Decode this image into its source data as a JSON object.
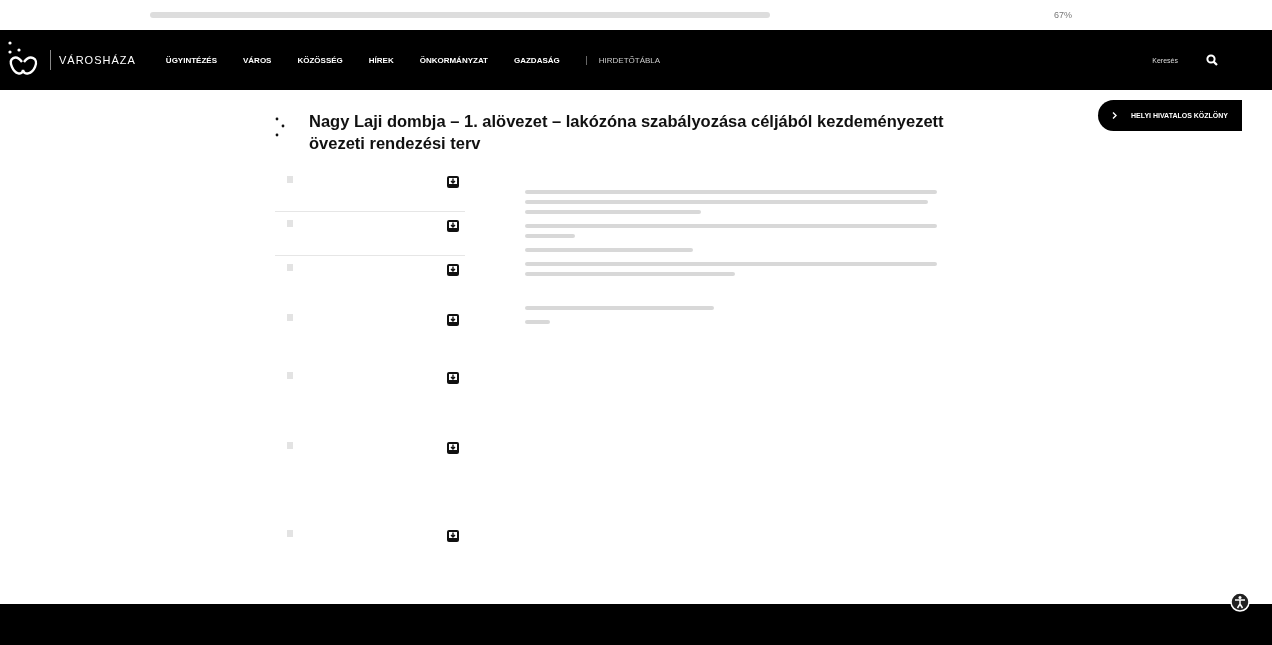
{
  "browser": {
    "zoom": "67%"
  },
  "header": {
    "logo_text": "VÁROSHÁZA",
    "nav": [
      {
        "label": "ÜGYINTÉZÉS",
        "kind": "main"
      },
      {
        "label": "VÁROS",
        "kind": "main"
      },
      {
        "label": "KÖZÖSSÉG",
        "kind": "main"
      },
      {
        "label": "HÍREK",
        "kind": "main"
      },
      {
        "label": "ÖNKORMÁNYZAT",
        "kind": "main"
      },
      {
        "label": "GAZDASÁG",
        "kind": "main"
      },
      {
        "label": "HIRDETŐTÁBLA",
        "kind": "secondary"
      }
    ],
    "search_label": "Keresés"
  },
  "gazette_button": "HELYI HIVATALOS KÖZLÖNY",
  "title": "Nagy Laji dombja – 1. alövezet – lakózóna szabályozása céljából kezdeményezett övezeti rendezési terv",
  "documents": [
    {
      "kind": "download"
    },
    {
      "kind": "download"
    },
    {
      "kind": "download"
    },
    {
      "kind": "download"
    },
    {
      "kind": "download"
    },
    {
      "kind": "download"
    },
    {
      "kind": "download"
    }
  ]
}
